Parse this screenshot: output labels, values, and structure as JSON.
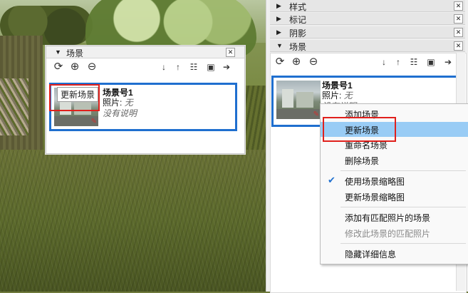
{
  "viewport": {
    "label": "SketchUp 3D model viewport"
  },
  "floating_panel": {
    "title": "场景",
    "tooltip": "更新场景",
    "scene": {
      "name": "场景号1",
      "photo_label": "照片:",
      "photo_value": "无",
      "description": "没有说明"
    }
  },
  "tray": {
    "sections": [
      {
        "label": "样式",
        "expanded": false
      },
      {
        "label": "标记",
        "expanded": false
      },
      {
        "label": "阴影",
        "expanded": false
      },
      {
        "label": "场景",
        "expanded": true
      }
    ],
    "scene": {
      "name": "场景号1",
      "photo_label": "照片:",
      "photo_value": "无",
      "description": "没有说明"
    }
  },
  "context_menu": {
    "items": [
      {
        "label": "添加场景",
        "highlighted": false,
        "checked": false,
        "disabled": false
      },
      {
        "label": "更新场景",
        "highlighted": true,
        "checked": false,
        "disabled": false
      },
      {
        "label": "重命名场景",
        "highlighted": false,
        "checked": false,
        "disabled": false
      },
      {
        "label": "删除场景",
        "highlighted": false,
        "checked": false,
        "disabled": false
      },
      {
        "label": "使用场景缩略图",
        "highlighted": false,
        "checked": true,
        "disabled": false
      },
      {
        "label": "更新场景缩略图",
        "highlighted": false,
        "checked": false,
        "disabled": false
      },
      {
        "label": "添加有匹配照片的场景",
        "highlighted": false,
        "checked": false,
        "disabled": false
      },
      {
        "label": "修改此场景的匹配照片",
        "highlighted": false,
        "checked": false,
        "disabled": true
      },
      {
        "label": "隐藏详细信息",
        "highlighted": false,
        "checked": false,
        "disabled": false
      }
    ]
  },
  "colors": {
    "accent_blue": "#1f6fcf",
    "highlight": "#99ccf5",
    "annotation_red": "#e0201c"
  }
}
